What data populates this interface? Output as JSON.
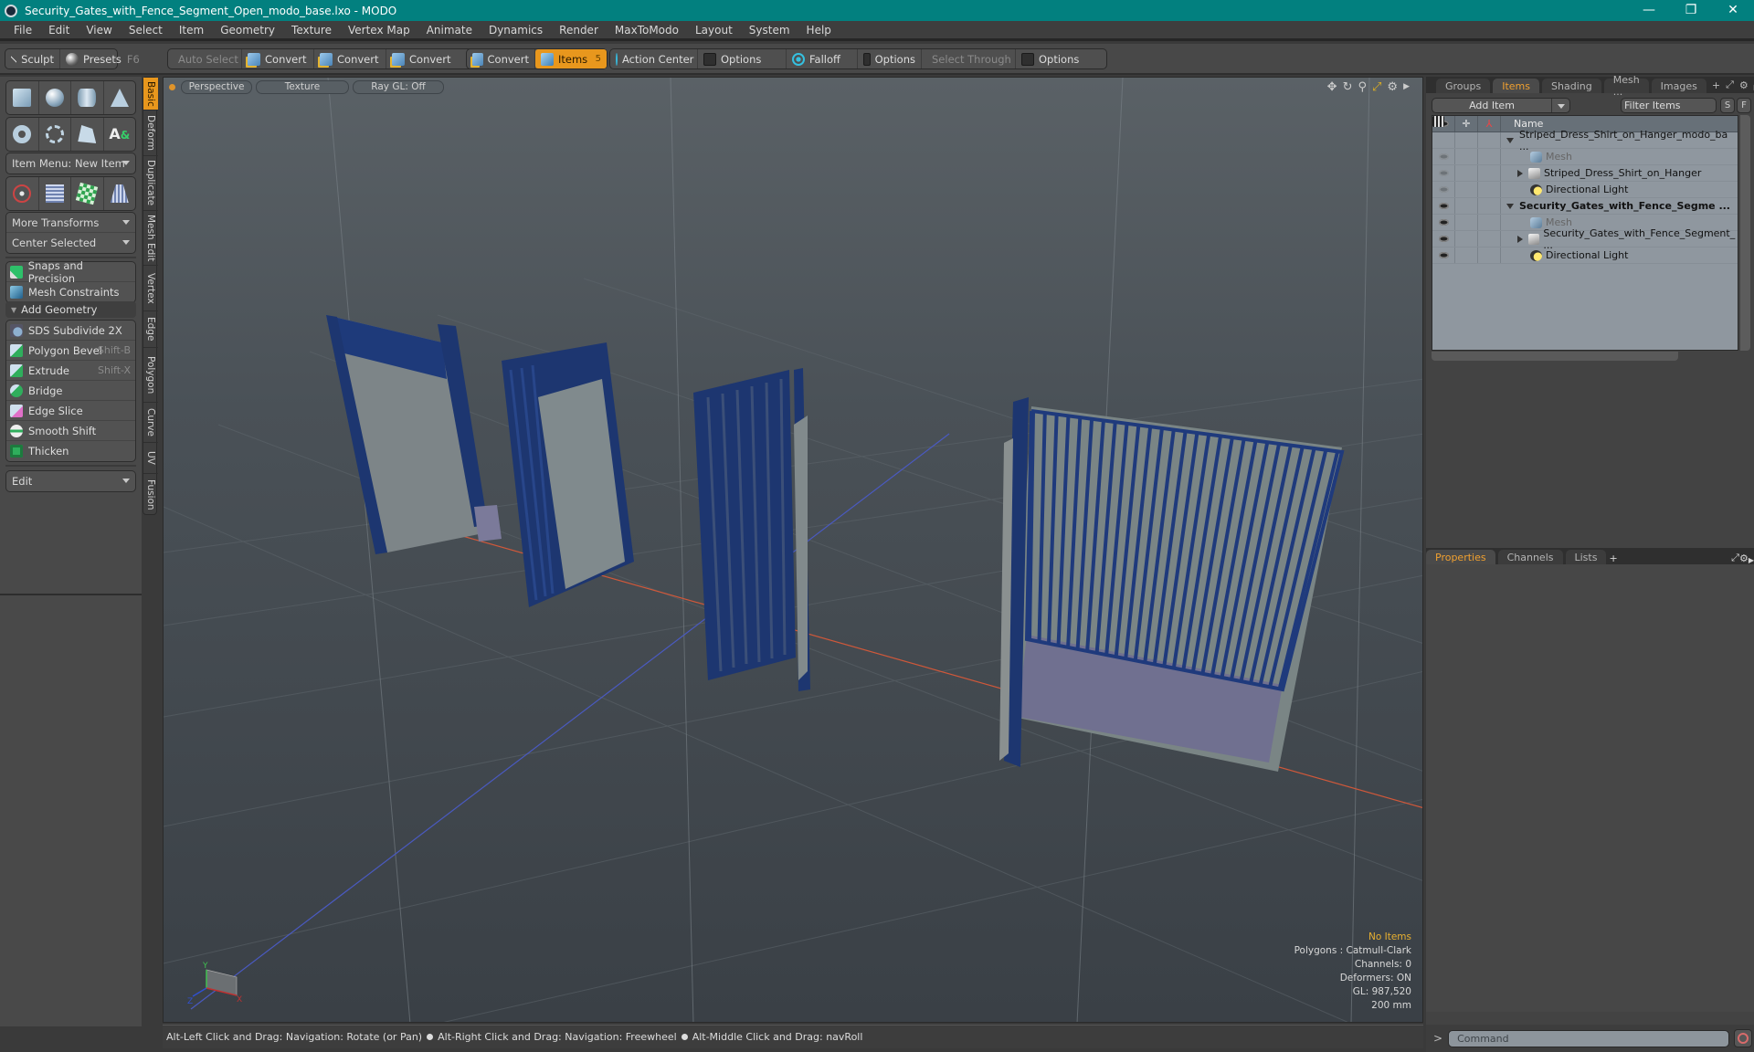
{
  "window": {
    "title": "Security_Gates_with_Fence_Segment_Open_modo_base.lxo - MODO",
    "controls": [
      "—",
      "❐",
      "✕"
    ]
  },
  "menubar": [
    "File",
    "Edit",
    "View",
    "Select",
    "Item",
    "Geometry",
    "Texture",
    "Vertex Map",
    "Animate",
    "Dynamics",
    "Render",
    "MaxToModo",
    "Layout",
    "System",
    "Help"
  ],
  "toolbar": {
    "sculpt": "Sculpt",
    "presets": "Presets",
    "presets_shortcut": "F6",
    "auto_select": "Auto Select",
    "convert1": "Convert",
    "convert2": "Convert",
    "convert3": "Convert",
    "convert4": "Convert",
    "items": "Items",
    "items_count": "5",
    "action_center": "Action Center",
    "options1": "Options",
    "falloff": "Falloff",
    "options2": "Options",
    "select_through": "Select Through",
    "options3": "Options"
  },
  "left_panel": {
    "item_menu": "Item Menu: New Item",
    "more_transforms": "More Transforms",
    "center_selected": "Center Selected",
    "snaps": "Snaps and Precision",
    "mesh_constraints": "Mesh Constraints",
    "add_geometry": "Add Geometry",
    "tools": [
      {
        "label": "SDS Subdivide 2X",
        "shortcut": ""
      },
      {
        "label": "Polygon Bevel",
        "shortcut": "Shift-B"
      },
      {
        "label": "Extrude",
        "shortcut": "Shift-X"
      },
      {
        "label": "Bridge",
        "shortcut": ""
      },
      {
        "label": "Edge Slice",
        "shortcut": ""
      },
      {
        "label": "Smooth Shift",
        "shortcut": ""
      },
      {
        "label": "Thicken",
        "shortcut": ""
      }
    ],
    "edit_dropdown": "Edit",
    "vertical_tabs": [
      "Basic",
      "Deform",
      "Duplicate",
      "Mesh Edit",
      "Vertex",
      "Edge",
      "Polygon",
      "Curve",
      "UV",
      "Fusion"
    ],
    "active_tab": "Basic"
  },
  "viewport": {
    "view_mode": "Perspective",
    "shading": "Texture",
    "raygl": "Ray GL: Off",
    "info": {
      "selection": "No Items",
      "polygons": "Polygons : Catmull-Clark",
      "channels": "Channels: 0",
      "deformers": "Deformers: ON",
      "gl": "GL: 987,520",
      "unit": "200 mm"
    },
    "axis_labels": {
      "x": "X",
      "y": "Y",
      "z": "Z"
    }
  },
  "statusbar": {
    "hint1": "Alt-Left Click and Drag: Navigation: Rotate (or Pan)",
    "hint2": "Alt-Right Click and Drag: Navigation: Freewheel",
    "hint3": "Alt-Middle Click and Drag: navRoll"
  },
  "right_panel": {
    "tabs": [
      "Groups",
      "Items",
      "Shading",
      "Mesh ...",
      "Images"
    ],
    "active_tab": "Items",
    "add_item": "Add Item",
    "filter_placeholder": "Filter Items",
    "s_btn": "S",
    "f_btn": "F",
    "name_header": "Name",
    "tree": [
      {
        "label": "Striped_Dress_Shirt_on_Hanger_modo_ba ...",
        "type": "scene",
        "level": 0,
        "expand": "down",
        "eye": "none",
        "bold": false,
        "dim": false
      },
      {
        "label": "Mesh",
        "type": "mesh",
        "level": 1,
        "expand": "none",
        "eye": "faint",
        "bold": false,
        "dim": true
      },
      {
        "label": "Striped_Dress_Shirt_on_Hanger",
        "type": "group",
        "level": 1,
        "expand": "right",
        "eye": "faint",
        "bold": false,
        "dim": false
      },
      {
        "label": "Directional Light",
        "type": "light",
        "level": 1,
        "expand": "none",
        "eye": "faint",
        "bold": false,
        "dim": false
      },
      {
        "label": "Security_Gates_with_Fence_Segme ...",
        "type": "scene",
        "level": 0,
        "expand": "down",
        "eye": "on",
        "bold": true,
        "dim": false
      },
      {
        "label": "Mesh",
        "type": "mesh",
        "level": 1,
        "expand": "none",
        "eye": "on",
        "bold": false,
        "dim": true
      },
      {
        "label": "Security_Gates_with_Fence_Segment_  ...",
        "type": "group",
        "level": 1,
        "expand": "right",
        "eye": "on",
        "bold": false,
        "dim": false
      },
      {
        "label": "Directional Light",
        "type": "light",
        "level": 1,
        "expand": "none",
        "eye": "on",
        "bold": false,
        "dim": false
      }
    ],
    "bottom_tabs": [
      "Properties",
      "Channels",
      "Lists"
    ],
    "bottom_active": "Properties",
    "command_placeholder": "Command",
    "prompt": ">"
  }
}
